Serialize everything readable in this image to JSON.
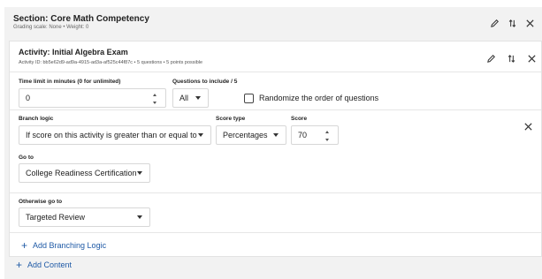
{
  "section": {
    "title": "Section: Core Math Competency",
    "meta": "Grading scale: None  •  Weight: 0"
  },
  "activity": {
    "title": "Activity: Initial Algebra Exam",
    "meta": "Activity ID: bb5e62d9-ad9a-4915-ad3a-af525c44f87c  •  5 questions  •  5 points possible"
  },
  "settings": {
    "time_limit_label": "Time limit in minutes (0 for unlimited)",
    "time_limit_value": "0",
    "questions_label": "Questions to include / 5",
    "questions_value": "All",
    "randomize_label": "Randomize the order of questions"
  },
  "branch": {
    "logic_label": "Branch logic",
    "logic_value": "If score on this activity is greater than or equal to",
    "score_type_label": "Score type",
    "score_type_value": "Percentages",
    "score_label": "Score",
    "score_value": "70",
    "goto_label": "Go to",
    "goto_value": "College Readiness Certification",
    "otherwise_label": "Otherwise go to",
    "otherwise_value": "Targeted Review"
  },
  "actions": {
    "add_branching": "Add Branching Logic",
    "add_content": "Add Content"
  },
  "icons": [
    "pencil-icon",
    "reorder-icon",
    "close-icon",
    "plus-icon"
  ]
}
